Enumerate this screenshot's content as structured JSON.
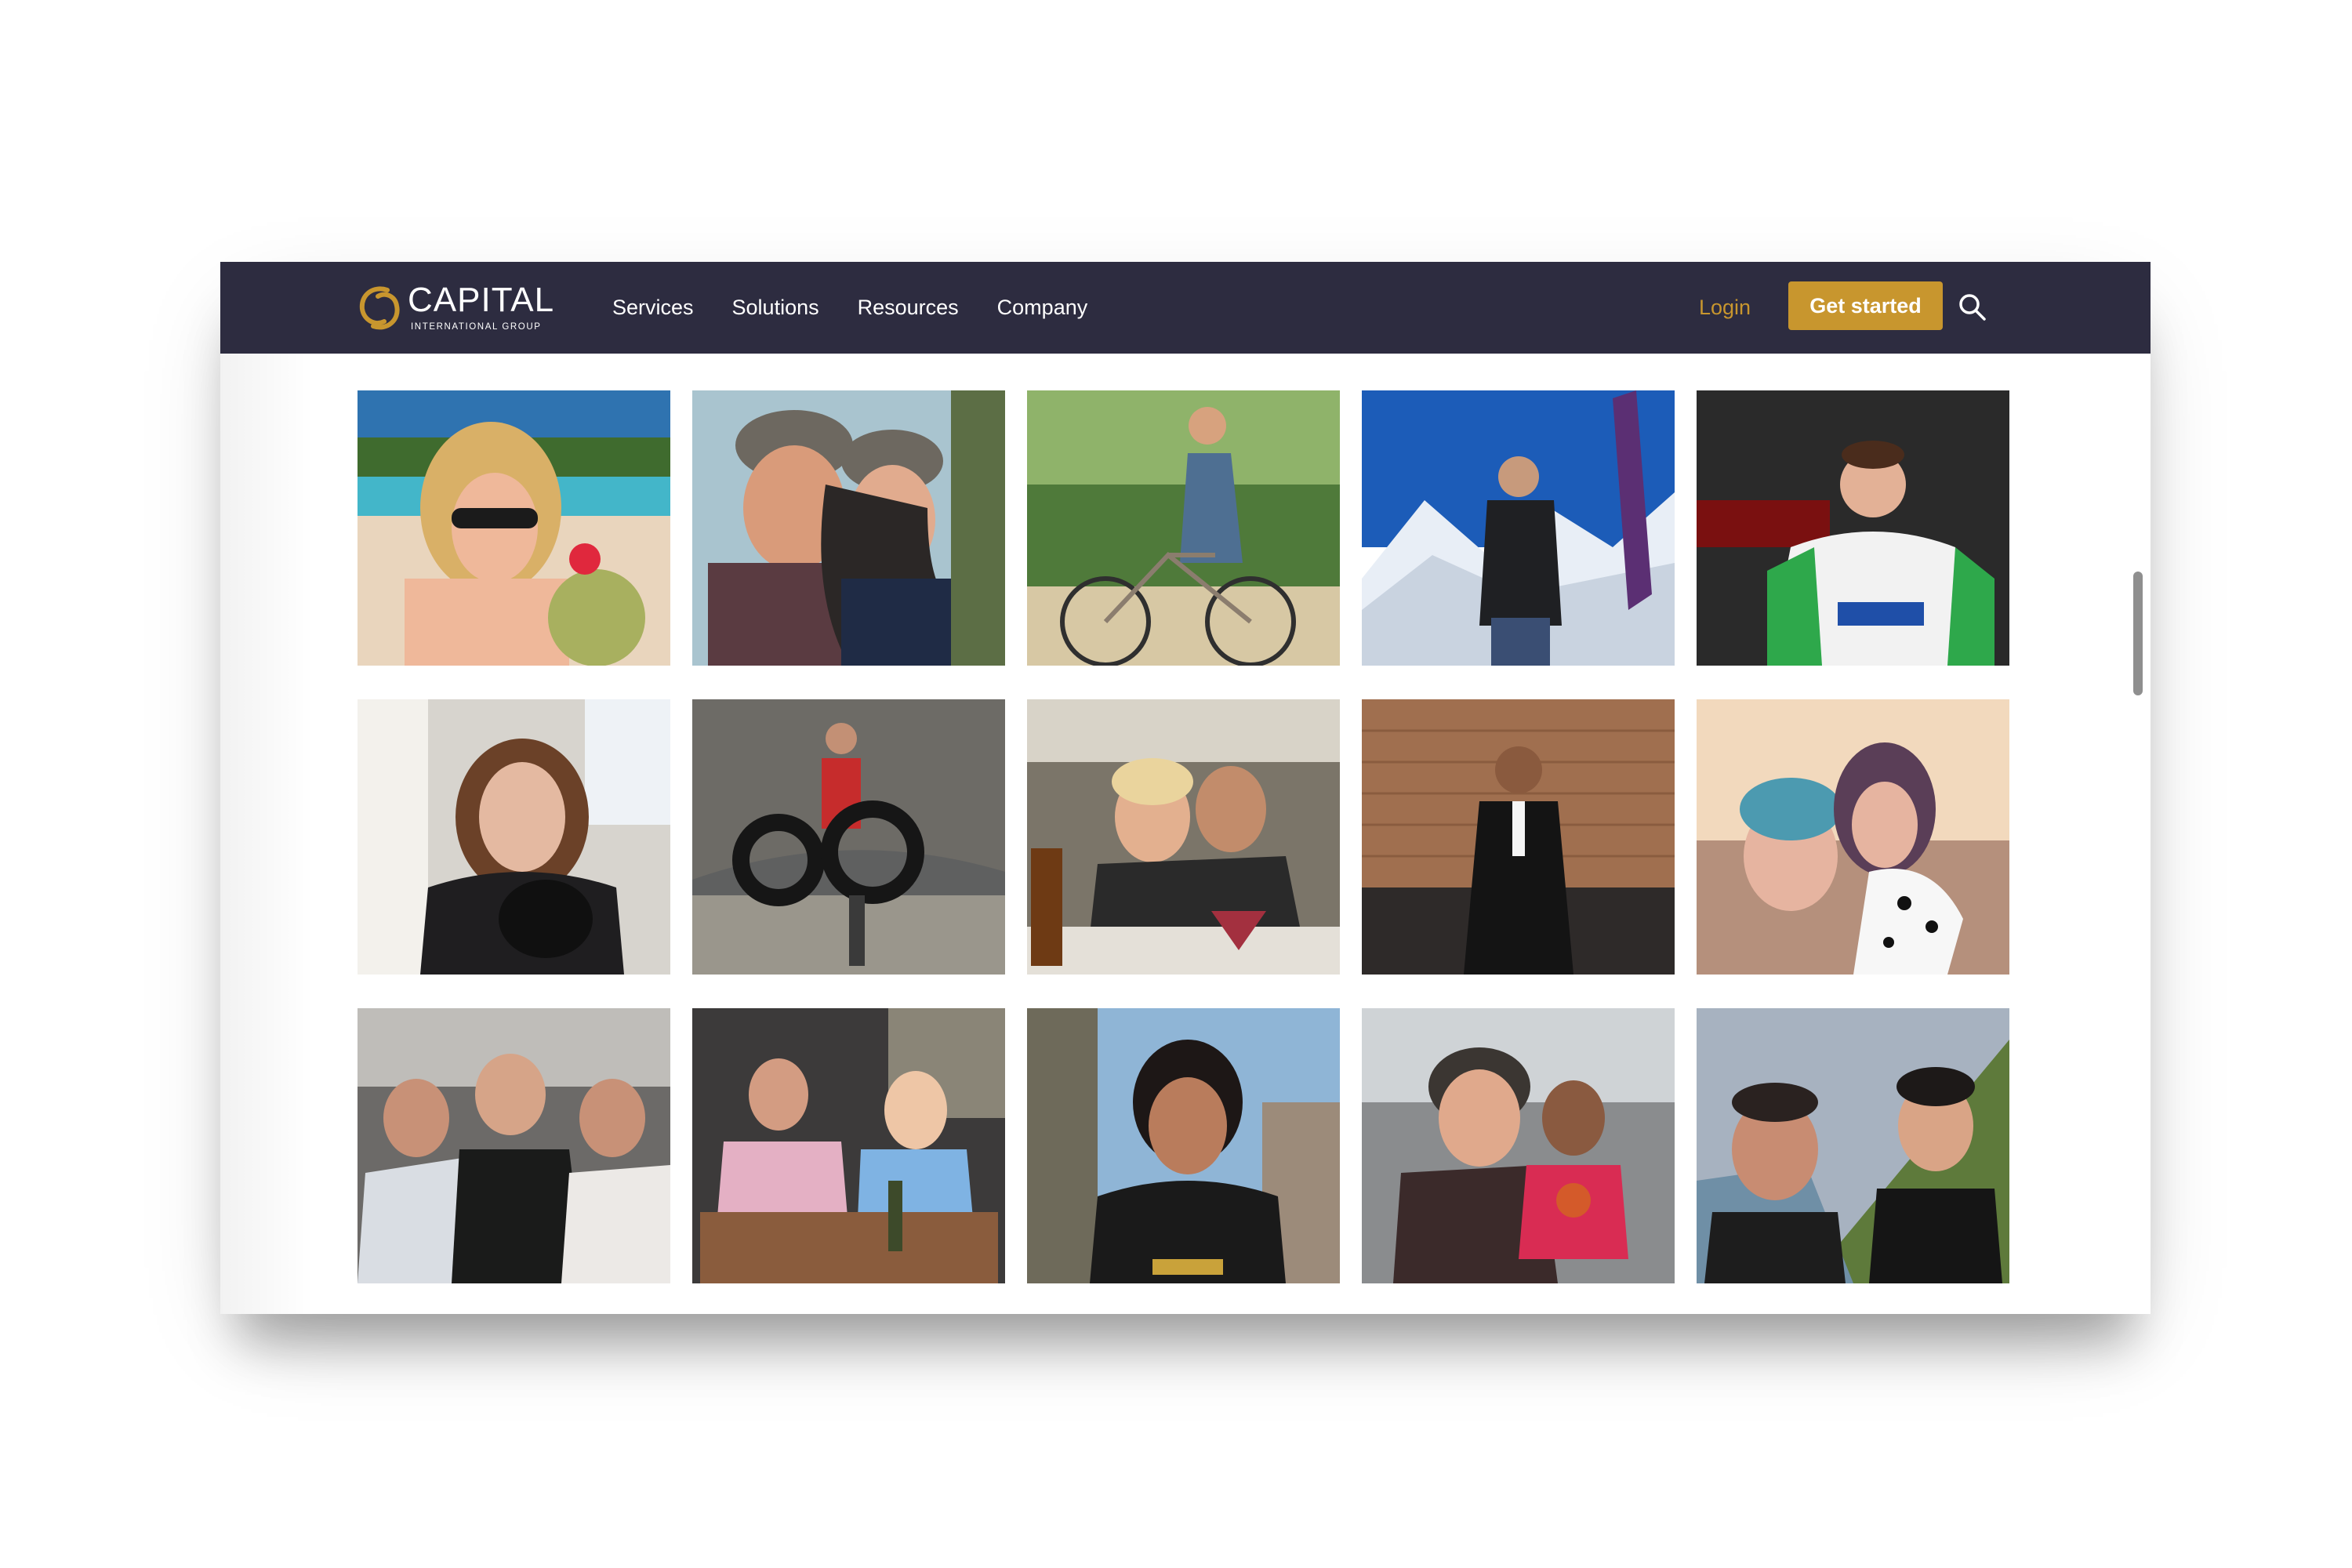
{
  "brand": {
    "name": "CAPITAL",
    "tagline": "INTERNATIONAL GROUP",
    "accent_color": "#c8962e",
    "nav_bg": "#2d2c40"
  },
  "nav": {
    "links": [
      "Services",
      "Solutions",
      "Resources",
      "Company"
    ],
    "login": "Login",
    "cta": "Get started",
    "search_icon": "search-icon"
  },
  "gallery": {
    "photos": [
      {
        "subject": "woman-with-coconut-on-beach"
      },
      {
        "subject": "father-and-daughter-selfie"
      },
      {
        "subject": "woman-riding-bicycle"
      },
      {
        "subject": "man-on-snowy-mountain"
      },
      {
        "subject": "motorcycle-racer-thumbs-up"
      },
      {
        "subject": "woman-holding-black-dog"
      },
      {
        "subject": "man-carrying-tubes-on-rocks"
      },
      {
        "subject": "couple-at-restaurant"
      },
      {
        "subject": "man-in-tuxedo"
      },
      {
        "subject": "couple-with-dalmatian"
      },
      {
        "subject": "three-friends-selfie"
      },
      {
        "subject": "couple-dining-outdoors"
      },
      {
        "subject": "smiling-woman-portrait"
      },
      {
        "subject": "grandmother-with-child"
      },
      {
        "subject": "two-men-hillside-selfie"
      }
    ]
  }
}
